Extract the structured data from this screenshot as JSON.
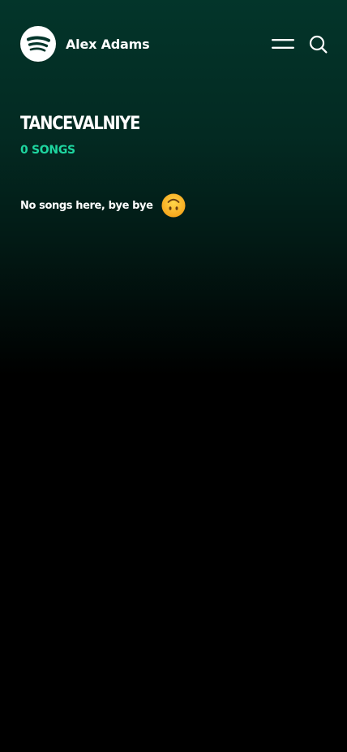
{
  "header": {
    "logo_icon": "spotify-logo-icon",
    "user_name": "Alex Adams",
    "menu_icon": "hamburger-menu-icon",
    "search_icon": "search-icon"
  },
  "playlist": {
    "title": "TANCEVALNIYE",
    "song_count": "0 SONGS",
    "empty_message": "No songs here, bye bye",
    "empty_emoji_icon": "upside-down-face-emoji-icon"
  },
  "colors": {
    "accent": "#1ed6a0",
    "background_top": "#03352a",
    "background_bottom": "#000000"
  }
}
